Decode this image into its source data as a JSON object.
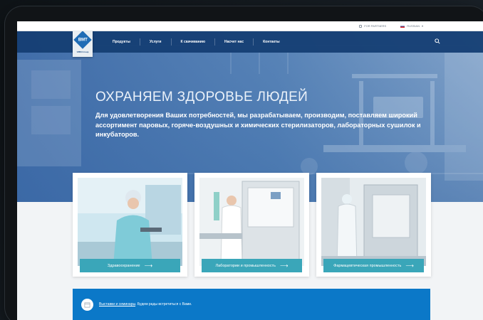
{
  "utility": {
    "partners": "FOR PARTNERS",
    "language": "RUSSIAN"
  },
  "logo": {
    "mark": "BMT",
    "sub": "VMM Group"
  },
  "nav": {
    "items": [
      {
        "label": "Продукты"
      },
      {
        "label": "Услуги"
      },
      {
        "label": "К скачиванию"
      },
      {
        "label": "Насчет нас"
      },
      {
        "label": "Контакты"
      }
    ]
  },
  "hero": {
    "title": "ОХРАНЯЕМ ЗДОРОВЬЕ ЛЮДЕЙ",
    "text": "Для удовлетворения Ваших потребностей, мы разрабатываем, производим, поставляем широкий ассортимент паровых, горяче-воздушных и химических стерилизаторов, лабораторных сушилок и инкубаторов."
  },
  "cards": [
    {
      "label": "Здравоохранение",
      "arrow": "⟶"
    },
    {
      "label": "Лаборатории и промышленность",
      "arrow": "⟶"
    },
    {
      "label": "Фармацевтическая промышленность",
      "arrow": "⟶"
    }
  ],
  "banner": {
    "link": "Выставки и семинары",
    "text": ". Будем рады встретиться с Вами."
  },
  "colors": {
    "nav": "#143e73",
    "accent": "#3aa6b9",
    "banner": "#0b78c8"
  }
}
